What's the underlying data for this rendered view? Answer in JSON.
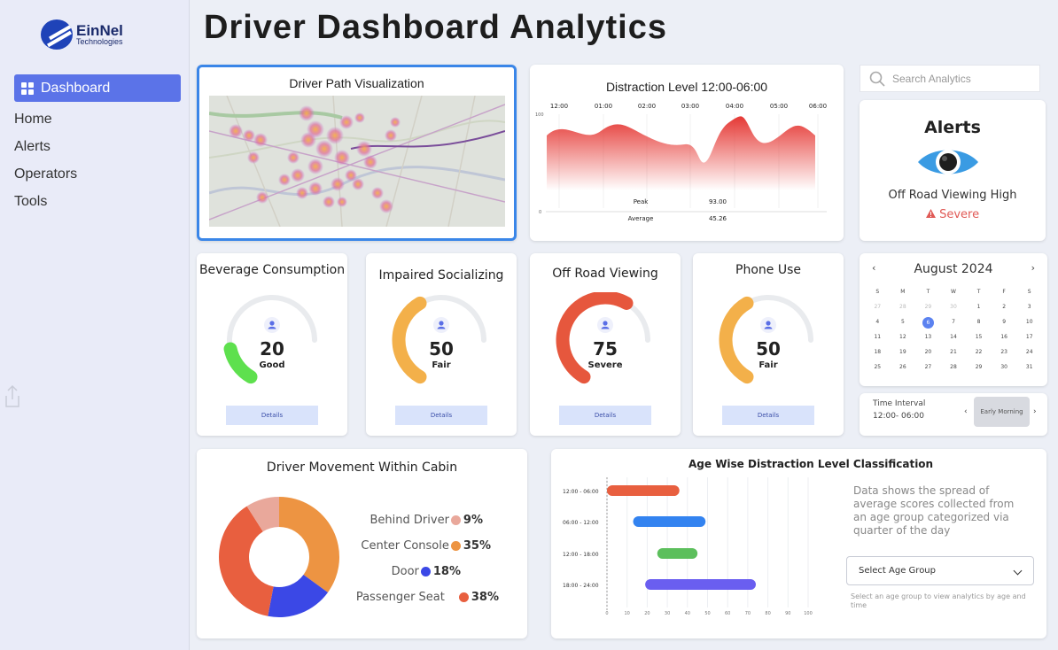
{
  "sidebar": {
    "logo": {
      "name": "EinNel",
      "sub": "Technologies"
    },
    "active_item": "Dashboard",
    "items": [
      "Home",
      "Alerts",
      "Operators",
      "Tools"
    ]
  },
  "title": "Driver Dashboard Analytics",
  "map": {
    "title": "Driver Path Visualization"
  },
  "distraction": {
    "title": "Distraction Level 12:00-06:00",
    "time_labels": [
      "12:00",
      "01:00",
      "02:00",
      "03:00",
      "04:00",
      "05:00",
      "06:00"
    ],
    "y_top": "100",
    "y_bottom": "0",
    "peak_label": "Peak",
    "peak_value": "93.00",
    "avg_label": "Average",
    "avg_value": "45.26",
    "color": "#e53935"
  },
  "search": {
    "placeholder": "Search Analytics"
  },
  "alerts": {
    "title": "Alerts",
    "description": "Off Road Viewing High",
    "severity": "Severe",
    "severity_color": "#e05a56",
    "eye_color": "#3a9be3"
  },
  "gauges": [
    {
      "label": "Beverage Consumption",
      "value": "20",
      "status": "Good",
      "fraction": 0.2,
      "color": "#5ee04e",
      "details": "Details"
    },
    {
      "label": "Impaired Socializing",
      "value": "50",
      "status": "Fair",
      "fraction": 0.5,
      "color": "#f3b04a",
      "details": "Details"
    },
    {
      "label": "Off Road Viewing",
      "value": "75",
      "status": "Severe",
      "fraction": 0.75,
      "color": "#e6573d",
      "details": "Details"
    },
    {
      "label": "Phone Use",
      "value": "50",
      "status": "Fair",
      "fraction": 0.5,
      "color": "#f3b04a",
      "details": "Details"
    }
  ],
  "calendar": {
    "month": "August 2024",
    "weekdays": [
      "S",
      "M",
      "T",
      "W",
      "T",
      "F",
      "S"
    ],
    "prev_days": [
      "27",
      "28",
      "29",
      "30"
    ],
    "days": [
      "1",
      "2",
      "3",
      "4",
      "5",
      "6",
      "7",
      "8",
      "9",
      "10",
      "11",
      "12",
      "13",
      "14",
      "15",
      "16",
      "17",
      "18",
      "19",
      "20",
      "21",
      "22",
      "23",
      "24",
      "25",
      "26",
      "27",
      "28",
      "29",
      "30",
      "31"
    ],
    "selected": "6",
    "prev_icon": "‹",
    "next_icon": "›"
  },
  "time_interval": {
    "label": "Time Interval",
    "value": "12:00- 06:00",
    "option": "Early Morning",
    "prev_icon": "‹",
    "next_icon": "›"
  },
  "cabin": {
    "title": "Driver Movement Within Cabin",
    "segments": [
      {
        "name": "Behind Driver",
        "pct": "9%",
        "value": 9,
        "color": "#e9a89b"
      },
      {
        "name": "Center Console",
        "pct": "35%",
        "value": 35,
        "color": "#ed9442"
      },
      {
        "name": "Door",
        "pct": "18%",
        "value": 18,
        "color": "#3b48e6"
      },
      {
        "name": "Passenger Seat",
        "pct": "38%",
        "value": 38,
        "color": "#e85f3f"
      }
    ]
  },
  "age": {
    "title": "Age Wise Distraction Level Classification",
    "description": "Data shows the spread of average scores collected from an age group categorized via quarter of the day",
    "select_label": "Select Age Group",
    "hint": "Select an age group to view analytics by age and time",
    "x_ticks": [
      "0",
      "10",
      "20",
      "30",
      "40",
      "50",
      "60",
      "70",
      "80",
      "90",
      "100"
    ],
    "bars": [
      {
        "label": "12:00 - 06:00",
        "start": 0,
        "end": 36,
        "color": "#e85f3f"
      },
      {
        "label": "06:00 - 12:00",
        "start": 13,
        "end": 49,
        "color": "#3383f0"
      },
      {
        "label": "12:00 - 18:00",
        "start": 25,
        "end": 45,
        "color": "#5cbf5c"
      },
      {
        "label": "18:00 - 24:00",
        "start": 19,
        "end": 74,
        "color": "#6a5ef0"
      }
    ]
  }
}
